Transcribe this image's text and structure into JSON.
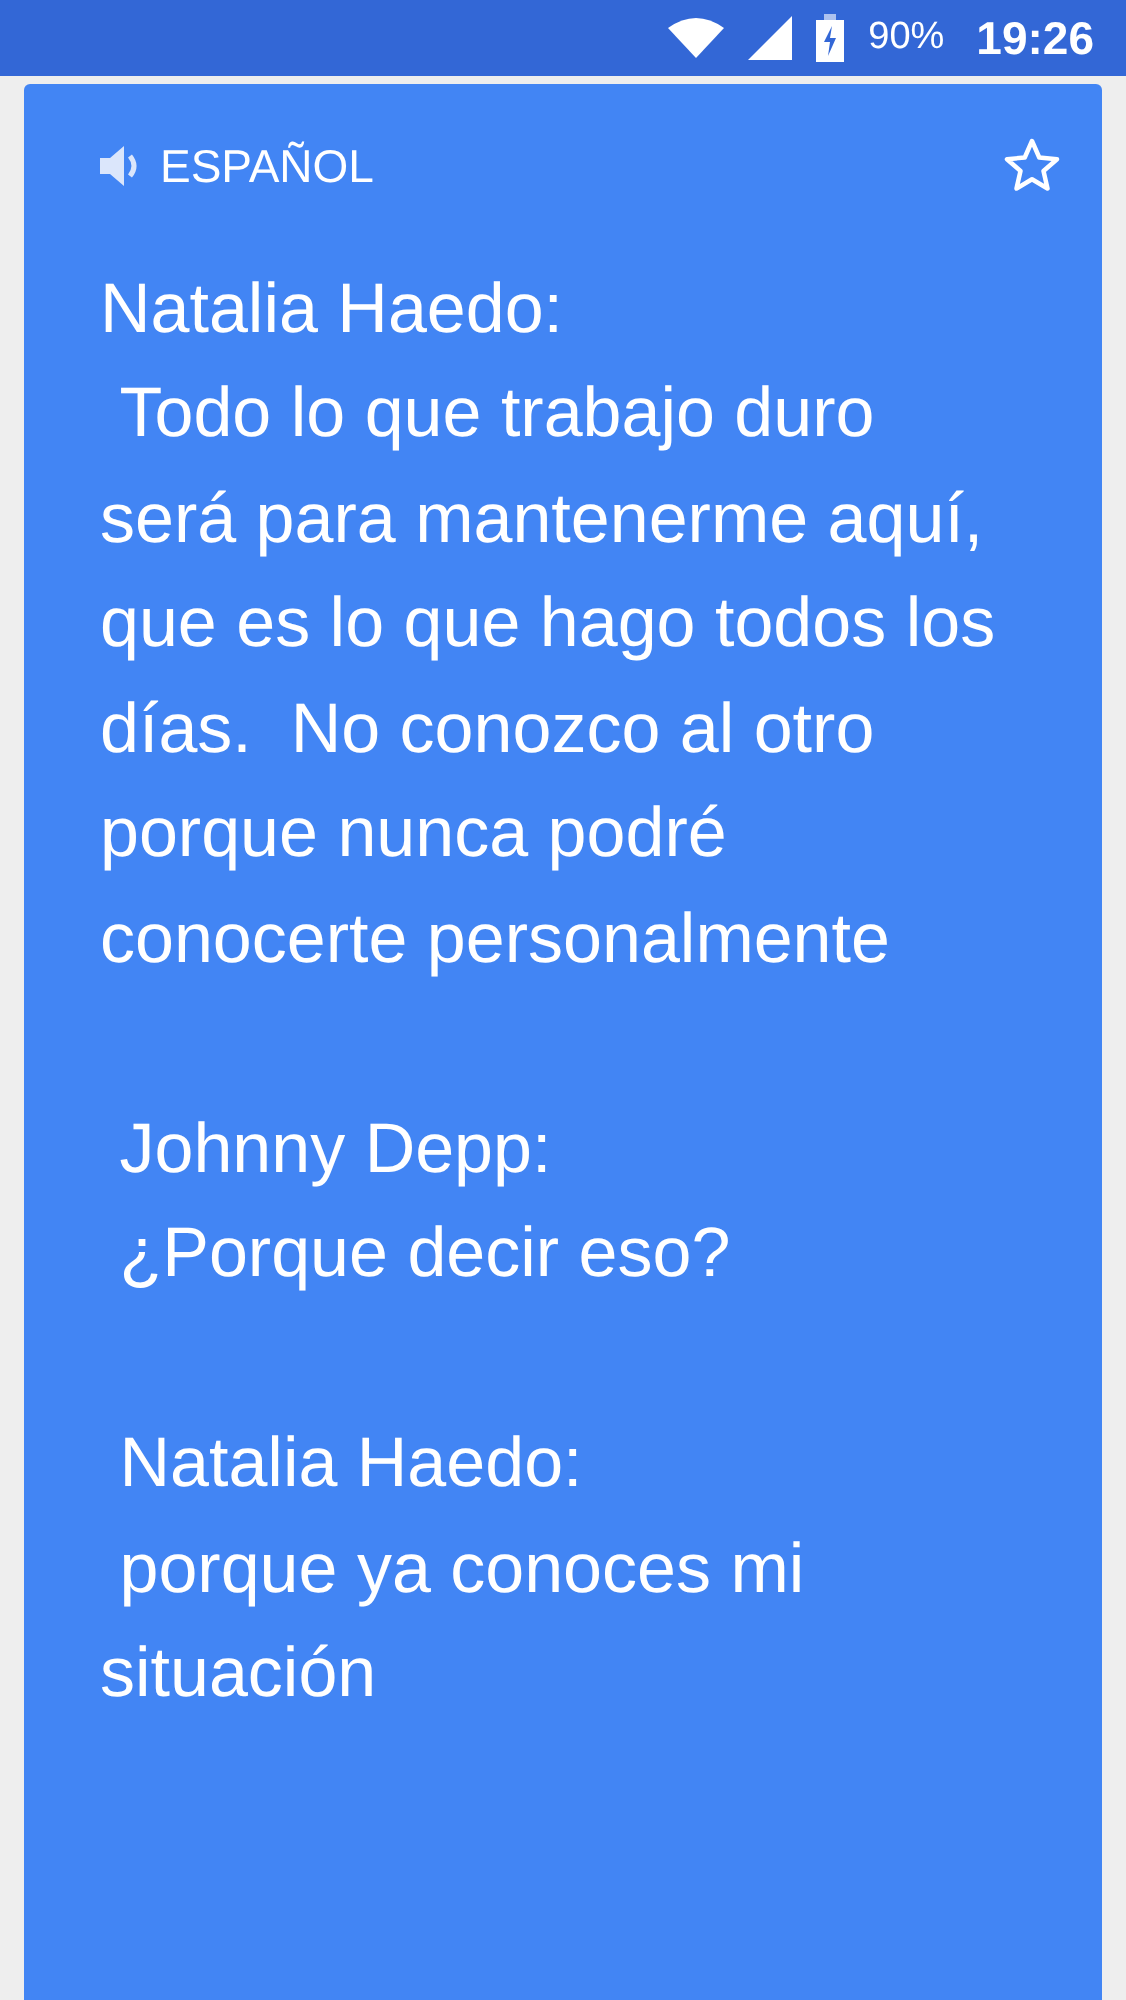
{
  "status_bar": {
    "battery": "90%",
    "time": "19:26"
  },
  "card": {
    "language": "ESPAÑOL",
    "starred": false,
    "text": "Natalia Haedo:\n Todo lo que trabajo duro será para mantenerme aquí, que es lo que hago todos los días.  No conozco al otro porque nunca podré conocerte personalmente\n\n Johnny Depp:\n ¿Porque decir eso?\n\n Natalia Haedo:\n porque ya conoces mi situación"
  }
}
